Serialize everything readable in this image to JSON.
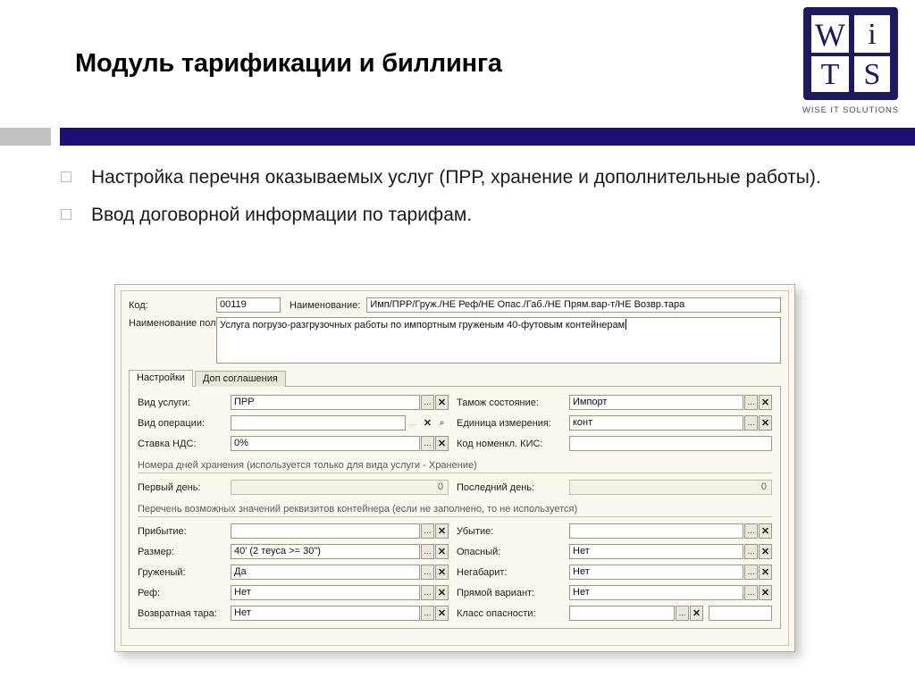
{
  "slide": {
    "title": "Модуль тарификации и биллинга",
    "bullets": [
      "Настройка перечня оказываемых услуг (ПРР, хранение и дополнительные работы).",
      "Ввод договорной информации по тарифам."
    ]
  },
  "logo": {
    "letters": [
      "W",
      "i",
      "T",
      "S"
    ],
    "tagline": "WISE IT SOLUTIONS",
    "mark_color": "#1c1075"
  },
  "theme": {
    "navy": "#1c1075",
    "gray_rule": "#c2c2c2",
    "form_bg": "#fbf9ef"
  },
  "form": {
    "header": {
      "code_label": "Код:",
      "code_value": "00119",
      "name_label": "Наименование:",
      "name_value": "Имп/ПРР/Груж./НЕ Реф/НЕ Опас./Габ./НЕ Прям.вар-т/НЕ Возвр.тара",
      "full_name_label": "Наименование полное (для печатных форм):",
      "full_name_value": "Услуга погрузо-разгрузочных работы по импортным груженым 40-футовым контейнерам"
    },
    "tabs": [
      {
        "label": "Настройки",
        "active": true
      },
      {
        "label": "Доп соглашения",
        "active": false
      }
    ],
    "settings": {
      "left": [
        {
          "label": "Вид услуги:",
          "value": "ПРР",
          "buttons": [
            "...",
            "x"
          ],
          "readonly": false
        },
        {
          "label": "Вид операции:",
          "value": "",
          "buttons": [
            "...",
            "x",
            "q"
          ],
          "readonly": false
        },
        {
          "label": "Ставка НДС:",
          "value": "0%",
          "buttons": [
            "...",
            "x"
          ],
          "readonly": false
        }
      ],
      "right": [
        {
          "label": "Тамож состояние:",
          "value": "Импорт",
          "buttons": [
            "...",
            "x"
          ],
          "readonly": false
        },
        {
          "label": "Единица измерения:",
          "value": "конт",
          "buttons": [
            "...",
            "x"
          ],
          "readonly": false
        },
        {
          "label": "Код номенкл. КИС:",
          "value": "",
          "buttons": [],
          "readonly": false
        }
      ]
    },
    "storage_section": {
      "title": "Номера дней хранения (используется только для вида услуги - Хранение)",
      "first_day_label": "Первый день:",
      "first_day_value": "0",
      "last_day_label": "Последний день:",
      "last_day_value": "0"
    },
    "container_section": {
      "title": "Перечень возможных значений реквизитов контейнера (если не заполнено, то не используется)",
      "left": [
        {
          "label": "Прибытие:",
          "value": ""
        },
        {
          "label": "Размер:",
          "value": "40' (2 теуса >= 30\")"
        },
        {
          "label": "Груженый:",
          "value": "Да"
        },
        {
          "label": "Реф:",
          "value": "Нет"
        },
        {
          "label": "Возвратная тара:",
          "value": "Нет"
        }
      ],
      "right": [
        {
          "label": "Убытие:",
          "value": ""
        },
        {
          "label": "Опасный:",
          "value": "Нет"
        },
        {
          "label": "Негабарит:",
          "value": "Нет"
        },
        {
          "label": "Прямой вариант:",
          "value": "Нет"
        },
        {
          "label": "Класс опасности:",
          "value": "",
          "value2": ""
        }
      ]
    },
    "icons": {
      "ellipsis": "...",
      "clear": "✕",
      "search": "⌕"
    }
  }
}
